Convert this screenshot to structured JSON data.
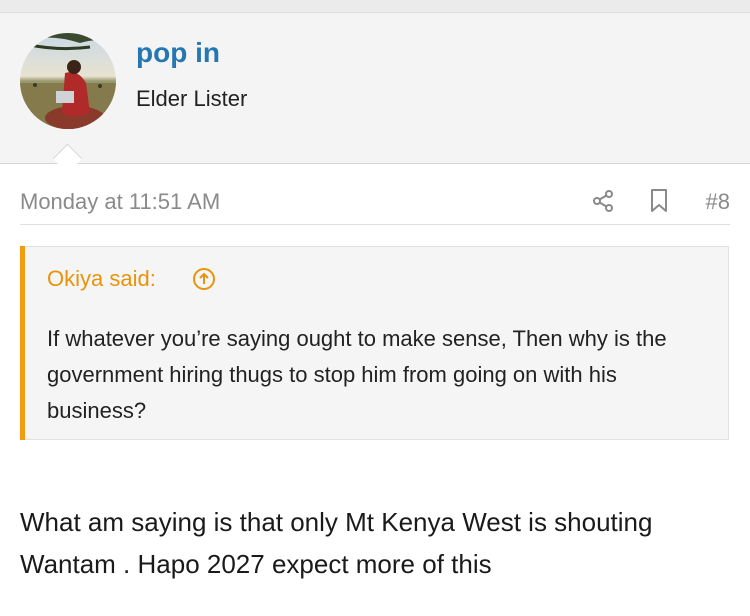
{
  "user": {
    "name": "pop in",
    "title": "Elder Lister"
  },
  "post": {
    "date": "Monday at 11:51 AM",
    "number": "#8",
    "share_icon": "share-icon",
    "bookmark_icon": "bookmark-icon"
  },
  "quote": {
    "author_label": "Okiya said:",
    "icon": "arrow-up-circle-icon",
    "text": "If whatever you’re saying ought to make sense, Then why is the government hiring thugs to stop him from going on with his business?"
  },
  "body": {
    "text": "What am saying is that only Mt Kenya West is shouting Wantam . Hapo 2027 expect more of this"
  },
  "colors": {
    "username": "#2577b1",
    "quote_accent": "#f39c12"
  }
}
